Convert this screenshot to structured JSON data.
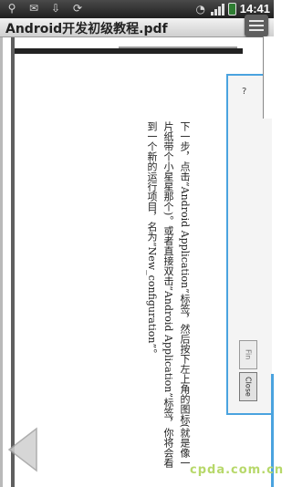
{
  "status_bar": {
    "time": "14:41",
    "icons": [
      "usb-icon",
      "notification-icon",
      "download-icon",
      "wifi-icon",
      "signal-icon",
      "battery-icon"
    ],
    "signal_level": 4
  },
  "title_bar": {
    "title": "Android开发初级教程.pdf"
  },
  "document": {
    "paragraph_1": "下一步，点击“Android Application”标签，然后按下左上角的图标(就是像一片纸带个小星星那个)。或者直接双击“Android Application”标签，你将会看到一个新的运行项目，名为“New_configuration”。",
    "dialog": {
      "help_glyph": "?",
      "finish_label": "Fin",
      "close_label": "Close"
    }
  },
  "watermark": {
    "text": "cpda.com.cn"
  },
  "colors": {
    "status_bar": "#2a2a2a",
    "accent_blue": "#4aa3df",
    "watermark_green": "#b7d86a"
  }
}
